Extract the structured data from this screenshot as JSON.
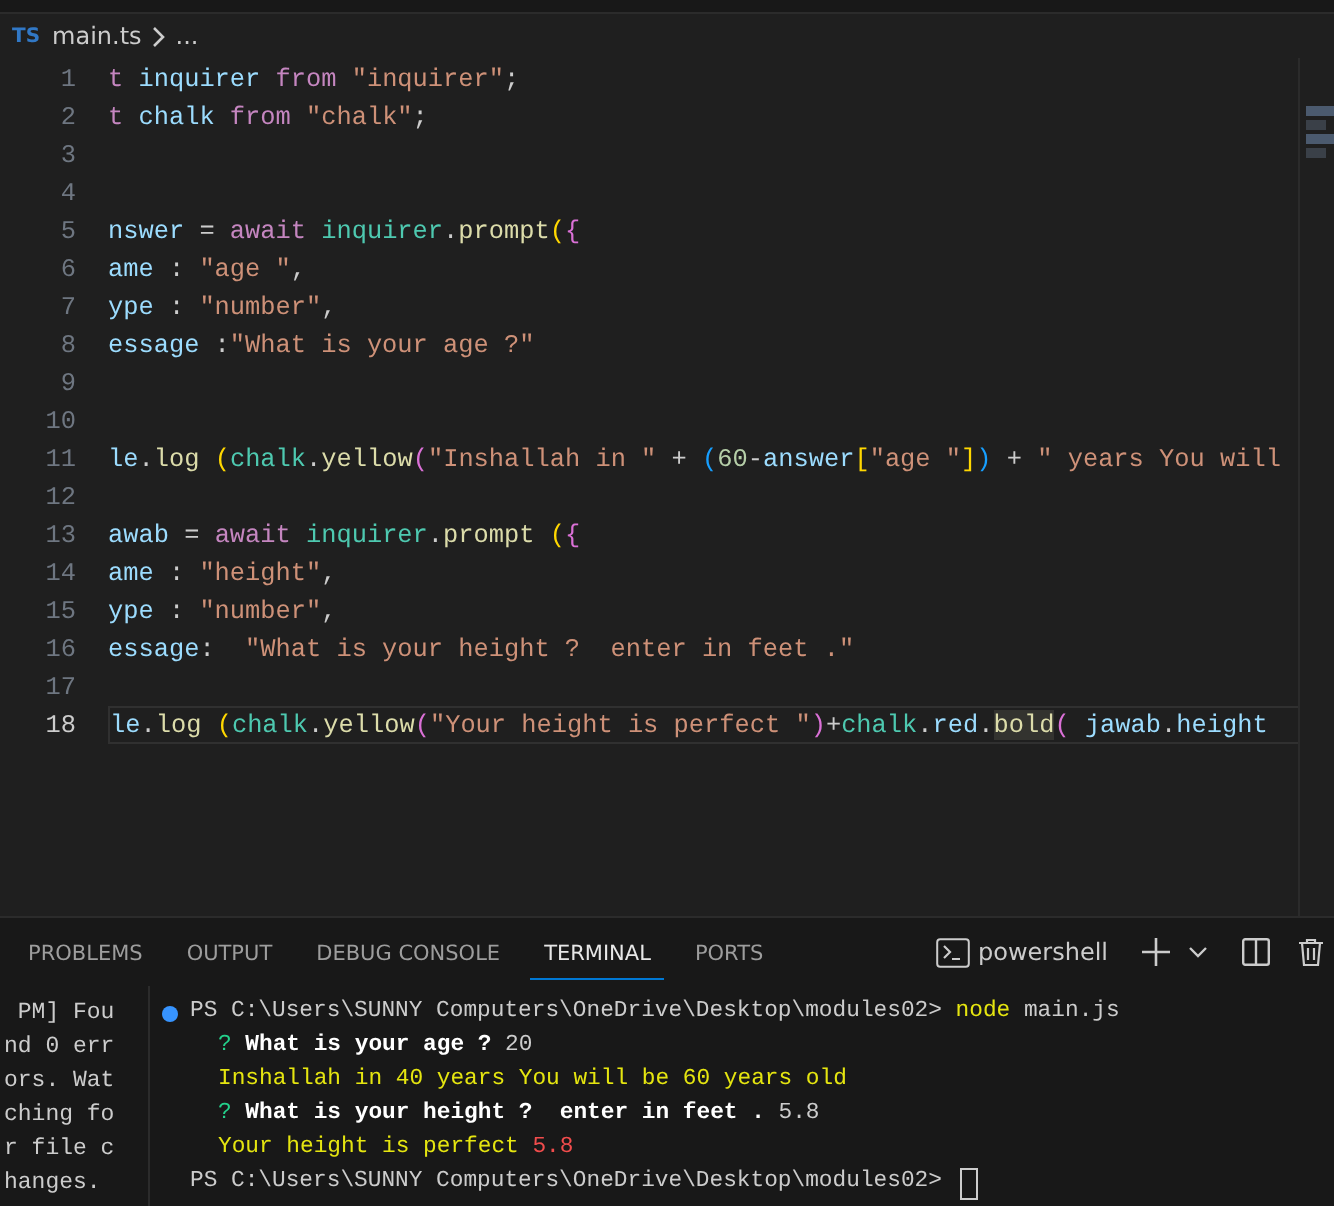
{
  "breadcrumb": {
    "file_badge": "TS",
    "file": "main.ts",
    "more": "..."
  },
  "editor": {
    "lines": [
      {
        "number": "1",
        "current": false,
        "tokens": [
          {
            "t": "t ",
            "color": "#c586c0"
          },
          {
            "t": "inquirer ",
            "color": "#9cdcfe"
          },
          {
            "t": "from ",
            "color": "#c586c0"
          },
          {
            "t": "\"inquirer\"",
            "color": "#ce9178"
          },
          {
            "t": ";",
            "color": "#cccccc"
          }
        ]
      },
      {
        "number": "2",
        "current": false,
        "tokens": [
          {
            "t": "t ",
            "color": "#c586c0"
          },
          {
            "t": "chalk ",
            "color": "#9cdcfe"
          },
          {
            "t": "from ",
            "color": "#c586c0"
          },
          {
            "t": "\"chalk\"",
            "color": "#ce9178"
          },
          {
            "t": ";",
            "color": "#cccccc"
          }
        ]
      },
      {
        "number": "3",
        "current": false
      },
      {
        "number": "4",
        "current": false
      },
      {
        "number": "5",
        "current": false,
        "tokens": [
          {
            "t": "nswer",
            "color": "#9cdcfe"
          },
          {
            "t": " = ",
            "color": "#cccccc"
          },
          {
            "t": "await ",
            "color": "#c586c0"
          },
          {
            "t": "inquirer",
            "color": "#4ec9b0"
          },
          {
            "t": ".",
            "color": "#cccccc"
          },
          {
            "t": "prompt",
            "color": "#dcdcaa"
          },
          {
            "t": "(",
            "color": "#ffd700"
          },
          {
            "t": "{",
            "color": "#da70d6"
          }
        ]
      },
      {
        "number": "6",
        "current": false,
        "tokens": [
          {
            "t": "ame",
            "color": "#9cdcfe"
          },
          {
            "t": " : ",
            "color": "#cccccc"
          },
          {
            "t": "\"age \"",
            "color": "#ce9178"
          },
          {
            "t": ",",
            "color": "#cccccc"
          }
        ]
      },
      {
        "number": "7",
        "current": false,
        "tokens": [
          {
            "t": "ype",
            "color": "#9cdcfe"
          },
          {
            "t": " : ",
            "color": "#cccccc"
          },
          {
            "t": "\"number\"",
            "color": "#ce9178"
          },
          {
            "t": ",",
            "color": "#cccccc"
          }
        ]
      },
      {
        "number": "8",
        "current": false,
        "tokens": [
          {
            "t": "essage",
            "color": "#9cdcfe"
          },
          {
            "t": " :",
            "color": "#cccccc"
          },
          {
            "t": "\"What is your age ?\"",
            "color": "#ce9178"
          }
        ]
      },
      {
        "number": "9",
        "current": false
      },
      {
        "number": "10",
        "current": false
      },
      {
        "number": "11",
        "current": false,
        "tokens": [
          {
            "t": "le",
            "color": "#9cdcfe"
          },
          {
            "t": ".",
            "color": "#cccccc"
          },
          {
            "t": "log ",
            "color": "#dcdcaa"
          },
          {
            "t": "(",
            "color": "#ffd700"
          },
          {
            "t": "chalk",
            "color": "#4ec9b0"
          },
          {
            "t": ".",
            "color": "#cccccc"
          },
          {
            "t": "yellow",
            "color": "#dcdcaa"
          },
          {
            "t": "(",
            "color": "#da70d6"
          },
          {
            "t": "\"Inshallah in \"",
            "color": "#ce9178"
          },
          {
            "t": " + ",
            "color": "#cccccc"
          },
          {
            "t": "(",
            "color": "#179fff"
          },
          {
            "t": "60",
            "color": "#b5cea8"
          },
          {
            "t": "-",
            "color": "#cccccc"
          },
          {
            "t": "answer",
            "color": "#9cdcfe"
          },
          {
            "t": "[",
            "color": "#ffd700"
          },
          {
            "t": "\"age \"",
            "color": "#ce9178"
          },
          {
            "t": "]",
            "color": "#ffd700"
          },
          {
            "t": ")",
            "color": "#179fff"
          },
          {
            "t": " + ",
            "color": "#cccccc"
          },
          {
            "t": "\" years You will",
            "color": "#ce9178"
          }
        ]
      },
      {
        "number": "12",
        "current": false
      },
      {
        "number": "13",
        "current": false,
        "tokens": [
          {
            "t": "awab",
            "color": "#9cdcfe"
          },
          {
            "t": " = ",
            "color": "#cccccc"
          },
          {
            "t": "await ",
            "color": "#c586c0"
          },
          {
            "t": "inquirer",
            "color": "#4ec9b0"
          },
          {
            "t": ".",
            "color": "#cccccc"
          },
          {
            "t": "prompt ",
            "color": "#dcdcaa"
          },
          {
            "t": "(",
            "color": "#ffd700"
          },
          {
            "t": "{",
            "color": "#da70d6"
          }
        ]
      },
      {
        "number": "14",
        "current": false,
        "tokens": [
          {
            "t": "ame",
            "color": "#9cdcfe"
          },
          {
            "t": " : ",
            "color": "#cccccc"
          },
          {
            "t": "\"height\"",
            "color": "#ce9178"
          },
          {
            "t": ",",
            "color": "#cccccc"
          }
        ]
      },
      {
        "number": "15",
        "current": false,
        "tokens": [
          {
            "t": "ype",
            "color": "#9cdcfe"
          },
          {
            "t": " : ",
            "color": "#cccccc"
          },
          {
            "t": "\"number\"",
            "color": "#ce9178"
          },
          {
            "t": ",",
            "color": "#cccccc"
          }
        ]
      },
      {
        "number": "16",
        "current": false,
        "tokens": [
          {
            "t": "essage",
            "color": "#9cdcfe"
          },
          {
            "t": ":  ",
            "color": "#cccccc"
          },
          {
            "t": "\"What is your height ?  enter in feet .\"",
            "color": "#ce9178"
          }
        ]
      },
      {
        "number": "17",
        "current": false
      },
      {
        "number": "18",
        "current": true,
        "tokens": [
          {
            "t": "le",
            "color": "#9cdcfe",
            "highlighted": false
          },
          {
            "t": ".",
            "color": "#cccccc",
            "highlighted": false
          },
          {
            "t": "log ",
            "color": "#dcdcaa",
            "highlighted": false
          },
          {
            "t": "(",
            "color": "#ffd700",
            "highlighted": false
          },
          {
            "t": "chalk",
            "color": "#4ec9b0",
            "highlighted": false
          },
          {
            "t": ".",
            "color": "#cccccc",
            "highlighted": false
          },
          {
            "t": "yellow",
            "color": "#dcdcaa",
            "highlighted": false
          },
          {
            "t": "(",
            "color": "#da70d6",
            "highlighted": false
          },
          {
            "t": "\"Your height is perfect \"",
            "color": "#ce9178",
            "highlighted": false
          },
          {
            "t": ")",
            "color": "#da70d6",
            "highlighted": false
          },
          {
            "t": "+",
            "color": "#cccccc",
            "highlighted": false
          },
          {
            "t": "chalk",
            "color": "#4ec9b0",
            "highlighted": false
          },
          {
            "t": ".",
            "color": "#cccccc",
            "highlighted": false
          },
          {
            "t": "red",
            "color": "#9cdcfe",
            "highlighted": false
          },
          {
            "t": ".",
            "color": "#cccccc",
            "highlighted": false
          },
          {
            "t": "bold",
            "color": "#dcdcaa",
            "highlighted": true
          },
          {
            "t": "( ",
            "color": "#da70d6",
            "highlighted": false
          },
          {
            "t": "jawab",
            "color": "#9cdcfe",
            "highlighted": false
          },
          {
            "t": ".",
            "color": "#cccccc",
            "highlighted": false
          },
          {
            "t": "height",
            "color": "#9cdcfe",
            "highlighted": false
          }
        ]
      }
    ]
  },
  "panel": {
    "tabs": [
      {
        "label": "PROBLEMS",
        "selected": false
      },
      {
        "label": "OUTPUT",
        "selected": false
      },
      {
        "label": "DEBUG CONSOLE",
        "selected": false
      },
      {
        "label": "TERMINAL",
        "selected": true
      },
      {
        "label": "PORTS",
        "selected": false
      }
    ],
    "shell": "powershell",
    "side_output": [
      " PM] Fou",
      "nd 0 err",
      "ors. Wat",
      "ching fo",
      "r file c",
      "hanges."
    ],
    "terminal": [
      {
        "kind": "command",
        "marker": true,
        "cursor": false,
        "tokens": [
          {
            "t": "PS C:\\Users\\SUNNY Computers\\OneDrive\\Desktop\\modules02> ",
            "color": "#cccccc"
          },
          {
            "t": "node",
            "color": "#e5e510"
          },
          {
            "t": " main.js",
            "color": "#cccccc"
          }
        ]
      },
      {
        "kind": "output",
        "marker": false,
        "cursor": false,
        "tokens": [
          {
            "t": "? ",
            "color": "#23d18b"
          },
          {
            "t": "**What is your age ?**",
            "color": "#ffffff"
          },
          {
            "t": " 20",
            "color": "#cccccc"
          }
        ]
      },
      {
        "kind": "output",
        "marker": false,
        "cursor": false,
        "tokens": [
          {
            "t": "Inshallah in 40 years You will be 60 years old",
            "color": "#e5e510"
          }
        ]
      },
      {
        "kind": "output",
        "marker": false,
        "cursor": false,
        "tokens": [
          {
            "t": "? ",
            "color": "#23d18b"
          },
          {
            "t": "**What is your height ?  enter in feet .**",
            "color": "#ffffff"
          },
          {
            "t": " 5.8",
            "color": "#cccccc"
          }
        ]
      },
      {
        "kind": "output",
        "marker": false,
        "cursor": false,
        "tokens": [
          {
            "t": "Your height is perfect ",
            "color": "#e5e510"
          },
          {
            "t": "5.8",
            "color": "#f14c4c"
          }
        ]
      },
      {
        "kind": "command",
        "marker": false,
        "cursor": true,
        "tokens": [
          {
            "t": "PS C:\\Users\\SUNNY Computers\\OneDrive\\Desktop\\modules02> ",
            "color": "#cccccc"
          }
        ]
      }
    ]
  }
}
